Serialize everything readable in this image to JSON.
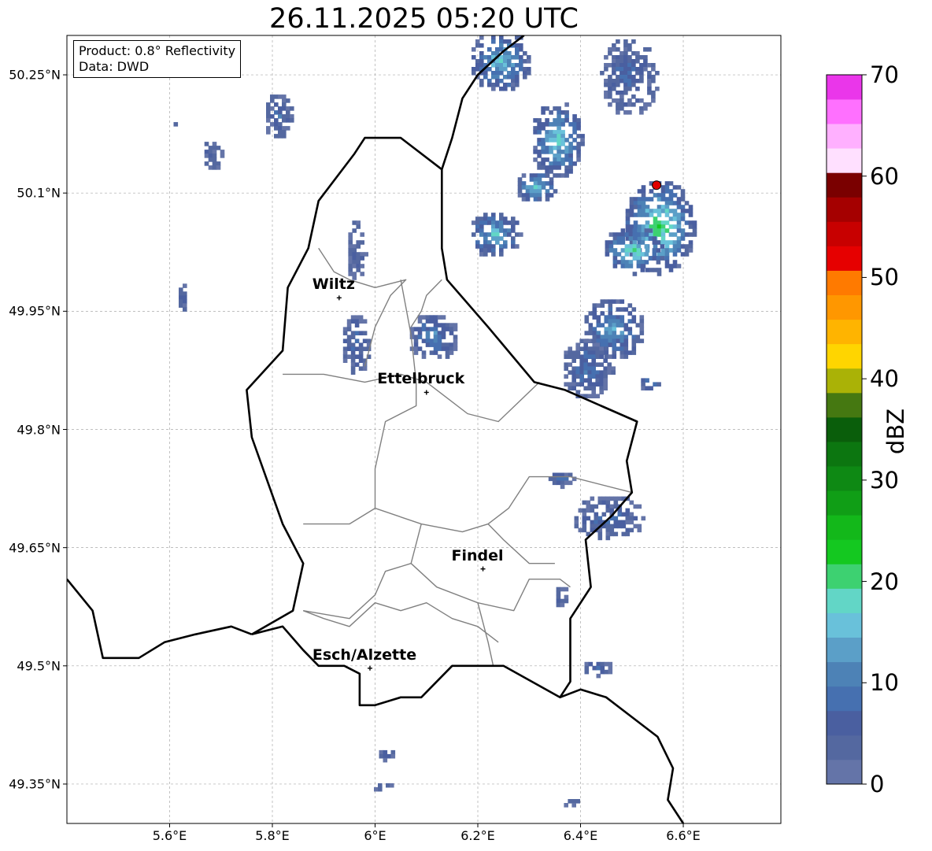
{
  "title": "26.11.2025 05:20 UTC",
  "info": {
    "product_line": "Product: 0.8° Reflectivity",
    "data_line": "Data: DWD"
  },
  "lat_ticks": [
    {
      "value": 50.25,
      "label": "50.25°N"
    },
    {
      "value": 50.1,
      "label": "50.1°N"
    },
    {
      "value": 49.95,
      "label": "49.95°N"
    },
    {
      "value": 49.8,
      "label": "49.8°N"
    },
    {
      "value": 49.65,
      "label": "49.65°N"
    },
    {
      "value": 49.5,
      "label": "49.5°N"
    },
    {
      "value": 49.35,
      "label": "49.35°N"
    }
  ],
  "lon_ticks": [
    {
      "value": 5.6,
      "label": "5.6°E"
    },
    {
      "value": 5.8,
      "label": "5.8°E"
    },
    {
      "value": 6.0,
      "label": "6°E"
    },
    {
      "value": 6.2,
      "label": "6.2°E"
    },
    {
      "value": 6.4,
      "label": "6.4°E"
    },
    {
      "value": 6.6,
      "label": "6.6°E"
    }
  ],
  "map_extent": {
    "lon_min": 5.4,
    "lon_max": 6.79,
    "lat_min": 49.3,
    "lat_max": 50.3
  },
  "cities": [
    {
      "name": "Wiltz",
      "lon": 5.93,
      "lat": 49.967
    },
    {
      "name": "Ettelbruck",
      "lon": 6.1,
      "lat": 49.847
    },
    {
      "name": "Findel",
      "lon": 6.21,
      "lat": 49.623
    },
    {
      "name": "Esch/Alzette",
      "lon": 5.99,
      "lat": 49.497
    }
  ],
  "radar_site": {
    "lon": 6.548,
    "lat": 50.11
  },
  "colorbar": {
    "label": "dBZ",
    "min": 0,
    "max": 70,
    "ticks": [
      {
        "value": 0,
        "label": "0"
      },
      {
        "value": 10,
        "label": "10"
      },
      {
        "value": 20,
        "label": "20"
      },
      {
        "value": 30,
        "label": "30"
      },
      {
        "value": 40,
        "label": "40"
      },
      {
        "value": 50,
        "label": "50"
      },
      {
        "value": 60,
        "label": "60"
      },
      {
        "value": 70,
        "label": "70"
      }
    ],
    "colors": [
      "#6474a8",
      "#5468a0",
      "#4a5fa0",
      "#4670b0",
      "#4d82b6",
      "#5b9fc8",
      "#69c1da",
      "#62d6c6",
      "#3dd171",
      "#14c820",
      "#13b81a",
      "#109e16",
      "#0e8914",
      "#0c7610",
      "#0a5e0b",
      "#457811",
      "#aab206",
      "#ffd500",
      "#ffb400",
      "#ff9700",
      "#ff7a00",
      "#e60000",
      "#c80000",
      "#a50000",
      "#7a0000",
      "#ffe0ff",
      "#ffb0ff",
      "#ff70ff",
      "#ea36ea"
    ]
  },
  "echoes": [
    {
      "lon": 6.55,
      "lat": 50.06,
      "rx": 0.07,
      "ry": 0.06,
      "dbz": 22
    },
    {
      "lon": 6.5,
      "lat": 50.03,
      "rx": 0.06,
      "ry": 0.03,
      "dbz": 20
    },
    {
      "lon": 6.35,
      "lat": 50.17,
      "rx": 0.05,
      "ry": 0.05,
      "dbz": 18
    },
    {
      "lon": 6.31,
      "lat": 50.11,
      "rx": 0.04,
      "ry": 0.02,
      "dbz": 18
    },
    {
      "lon": 6.23,
      "lat": 50.05,
      "rx": 0.05,
      "ry": 0.03,
      "dbz": 16
    },
    {
      "lon": 6.24,
      "lat": 50.27,
      "rx": 0.06,
      "ry": 0.04,
      "dbz": 16
    },
    {
      "lon": 6.49,
      "lat": 50.25,
      "rx": 0.06,
      "ry": 0.05,
      "dbz": 8
    },
    {
      "lon": 6.46,
      "lat": 49.93,
      "rx": 0.06,
      "ry": 0.04,
      "dbz": 14
    },
    {
      "lon": 6.41,
      "lat": 49.88,
      "rx": 0.05,
      "ry": 0.04,
      "dbz": 10
    },
    {
      "lon": 6.11,
      "lat": 49.92,
      "rx": 0.05,
      "ry": 0.03,
      "dbz": 12
    },
    {
      "lon": 5.96,
      "lat": 49.91,
      "rx": 0.03,
      "ry": 0.04,
      "dbz": 8
    },
    {
      "lon": 5.96,
      "lat": 50.03,
      "rx": 0.02,
      "ry": 0.04,
      "dbz": 6
    },
    {
      "lon": 6.45,
      "lat": 49.69,
      "rx": 0.07,
      "ry": 0.03,
      "dbz": 8
    },
    {
      "lon": 6.36,
      "lat": 49.74,
      "rx": 0.03,
      "ry": 0.01,
      "dbz": 8
    },
    {
      "lon": 5.81,
      "lat": 50.2,
      "rx": 0.03,
      "ry": 0.03,
      "dbz": 8
    },
    {
      "lon": 5.68,
      "lat": 50.15,
      "rx": 0.02,
      "ry": 0.02,
      "dbz": 6
    },
    {
      "lon": 5.61,
      "lat": 50.19,
      "rx": 0.01,
      "ry": 0.01,
      "dbz": 6
    },
    {
      "lon": 5.62,
      "lat": 49.97,
      "rx": 0.01,
      "ry": 0.02,
      "dbz": 6
    },
    {
      "lon": 6.43,
      "lat": 49.5,
      "rx": 0.03,
      "ry": 0.01,
      "dbz": 10
    },
    {
      "lon": 6.02,
      "lat": 49.39,
      "rx": 0.02,
      "ry": 0.008,
      "dbz": 6
    },
    {
      "lon": 6.01,
      "lat": 49.35,
      "rx": 0.02,
      "ry": 0.006,
      "dbz": 6
    },
    {
      "lon": 6.38,
      "lat": 49.33,
      "rx": 0.02,
      "ry": 0.006,
      "dbz": 6
    },
    {
      "lon": 6.36,
      "lat": 49.59,
      "rx": 0.015,
      "ry": 0.015,
      "dbz": 6
    },
    {
      "lon": 6.53,
      "lat": 49.86,
      "rx": 0.02,
      "ry": 0.01,
      "dbz": 12
    }
  ],
  "borders": {
    "luxembourg": [
      [
        5.76,
        49.54
      ],
      [
        5.82,
        49.55
      ],
      [
        5.86,
        49.52
      ],
      [
        5.89,
        49.5
      ],
      [
        5.92,
        49.5
      ],
      [
        5.94,
        49.5
      ],
      [
        5.97,
        49.49
      ],
      [
        5.97,
        49.45
      ],
      [
        6.0,
        49.45
      ],
      [
        6.05,
        49.46
      ],
      [
        6.09,
        49.46
      ],
      [
        6.15,
        49.5
      ],
      [
        6.25,
        49.5
      ],
      [
        6.36,
        49.46
      ],
      [
        6.38,
        49.48
      ],
      [
        6.38,
        49.56
      ],
      [
        6.42,
        49.6
      ],
      [
        6.41,
        49.66
      ],
      [
        6.46,
        49.69
      ],
      [
        6.5,
        49.72
      ],
      [
        6.49,
        49.76
      ],
      [
        6.51,
        49.81
      ],
      [
        6.44,
        49.83
      ],
      [
        6.37,
        49.85
      ],
      [
        6.31,
        49.86
      ],
      [
        6.22,
        49.93
      ],
      [
        6.14,
        49.99
      ],
      [
        6.13,
        50.03
      ],
      [
        6.13,
        50.08
      ],
      [
        6.13,
        50.13
      ],
      [
        6.05,
        50.17
      ],
      [
        6.02,
        50.17
      ],
      [
        5.98,
        50.17
      ],
      [
        5.96,
        50.15
      ],
      [
        5.89,
        50.09
      ],
      [
        5.87,
        50.03
      ],
      [
        5.83,
        49.98
      ],
      [
        5.82,
        49.9
      ],
      [
        5.75,
        49.85
      ],
      [
        5.76,
        49.79
      ],
      [
        5.82,
        49.68
      ],
      [
        5.86,
        49.63
      ],
      [
        5.84,
        49.57
      ],
      [
        5.76,
        49.54
      ]
    ],
    "france_belgium": [
      [
        5.4,
        49.61
      ],
      [
        5.45,
        49.57
      ],
      [
        5.47,
        49.51
      ],
      [
        5.54,
        49.51
      ],
      [
        5.59,
        49.53
      ],
      [
        5.65,
        49.54
      ],
      [
        5.72,
        49.55
      ],
      [
        5.76,
        49.54
      ]
    ],
    "germany_east": [
      [
        6.36,
        49.46
      ],
      [
        6.4,
        49.47
      ],
      [
        6.45,
        49.46
      ],
      [
        6.51,
        49.43
      ],
      [
        6.55,
        49.41
      ],
      [
        6.58,
        49.37
      ],
      [
        6.57,
        49.33
      ],
      [
        6.6,
        49.3
      ]
    ],
    "belgium_germany": [
      [
        6.13,
        50.13
      ],
      [
        6.15,
        50.17
      ],
      [
        6.17,
        50.22
      ],
      [
        6.2,
        50.25
      ],
      [
        6.25,
        50.28
      ],
      [
        6.29,
        50.3
      ]
    ],
    "cantons": [
      [
        [
          5.82,
          49.87
        ],
        [
          5.9,
          49.87
        ],
        [
          5.98,
          49.86
        ],
        [
          6.05,
          49.87
        ],
        [
          6.1,
          49.86
        ],
        [
          6.18,
          49.82
        ],
        [
          6.24,
          49.81
        ],
        [
          6.32,
          49.86
        ]
      ],
      [
        [
          5.89,
          50.03
        ],
        [
          5.92,
          50.0
        ],
        [
          5.95,
          49.99
        ],
        [
          6.0,
          49.98
        ],
        [
          6.06,
          49.99
        ],
        [
          6.03,
          49.97
        ],
        [
          6.0,
          49.93
        ],
        [
          5.98,
          49.88
        ]
      ],
      [
        [
          6.05,
          49.99
        ],
        [
          6.07,
          49.92
        ],
        [
          6.08,
          49.86
        ],
        [
          6.08,
          49.83
        ],
        [
          6.02,
          49.81
        ],
        [
          6.0,
          49.75
        ],
        [
          6.0,
          49.7
        ],
        [
          5.95,
          49.68
        ],
        [
          5.86,
          49.68
        ]
      ],
      [
        [
          6.0,
          49.7
        ],
        [
          6.09,
          49.68
        ],
        [
          6.17,
          49.67
        ],
        [
          6.22,
          49.68
        ],
        [
          6.26,
          49.7
        ],
        [
          6.3,
          49.74
        ],
        [
          6.38,
          49.74
        ],
        [
          6.5,
          49.72
        ]
      ],
      [
        [
          6.09,
          49.68
        ],
        [
          6.07,
          49.63
        ],
        [
          6.02,
          49.62
        ],
        [
          6.0,
          49.59
        ],
        [
          5.95,
          49.56
        ],
        [
          5.86,
          49.57
        ]
      ],
      [
        [
          6.07,
          49.63
        ],
        [
          6.12,
          49.6
        ],
        [
          6.2,
          49.58
        ],
        [
          6.27,
          49.57
        ],
        [
          6.3,
          49.61
        ],
        [
          6.36,
          49.61
        ],
        [
          6.38,
          49.6
        ]
      ],
      [
        [
          6.22,
          49.68
        ],
        [
          6.25,
          49.66
        ],
        [
          6.3,
          49.63
        ],
        [
          6.35,
          49.63
        ]
      ],
      [
        [
          6.2,
          49.58
        ],
        [
          6.22,
          49.53
        ],
        [
          6.23,
          49.5
        ]
      ],
      [
        [
          5.86,
          49.57
        ],
        [
          5.9,
          49.56
        ],
        [
          5.95,
          49.55
        ],
        [
          6.0,
          49.58
        ],
        [
          6.05,
          49.57
        ],
        [
          6.1,
          49.58
        ],
        [
          6.15,
          49.56
        ],
        [
          6.2,
          49.55
        ],
        [
          6.24,
          49.53
        ]
      ],
      [
        [
          6.13,
          49.99
        ],
        [
          6.1,
          49.97
        ],
        [
          6.09,
          49.95
        ],
        [
          6.07,
          49.93
        ]
      ]
    ]
  }
}
